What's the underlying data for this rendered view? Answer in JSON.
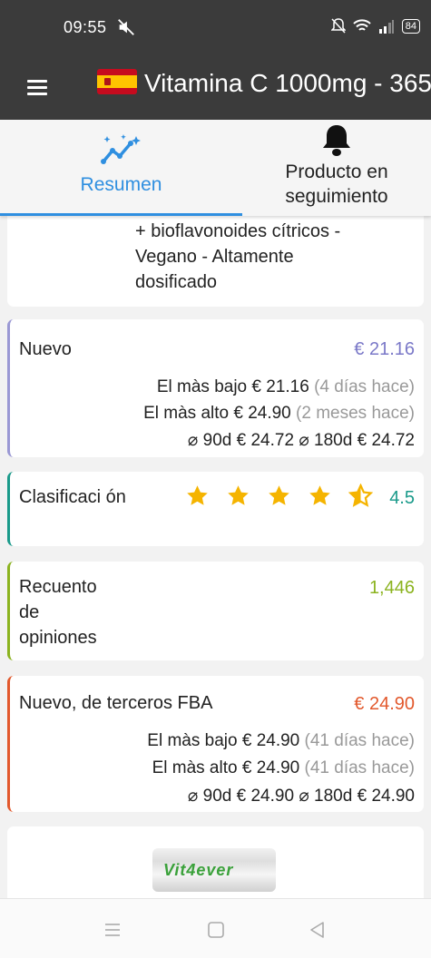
{
  "status": {
    "time": "09:55",
    "battery": "84"
  },
  "app": {
    "title": "Vitamina C 1000mg - 365"
  },
  "tabs": [
    {
      "label": "Resumen",
      "icon": "analytics-sparkle-icon"
    },
    {
      "label": "Producto en seguimiento",
      "icon": "bell-icon"
    }
  ],
  "description": {
    "text": "+ bioflavonoides cítricos - Vegano - Altamente dosificado"
  },
  "new_price": {
    "label": "Nuevo",
    "price": "€ 21.16",
    "color": "#7b79c8",
    "lowest_label": "El màs bajo",
    "lowest_value": "€ 21.16",
    "lowest_when": "(4 días hace)",
    "highest_label": "El màs alto",
    "highest_value": "€ 24.90",
    "highest_when": "(2 meses hace)",
    "avg90_label": "⌀ 90d",
    "avg90_value": "€ 24.72",
    "avg180_label": "⌀ 180d",
    "avg180_value": "€ 24.72"
  },
  "rating": {
    "label": "Clasificaci ón",
    "value": "4.5",
    "stars": 4.5,
    "color": "#1a9a8a"
  },
  "reviews": {
    "label": "Recuento de opiniones",
    "value": "1,446",
    "color": "#8bb31f"
  },
  "fba": {
    "label": "Nuevo, de terceros FBA",
    "price": "€ 24.90",
    "color": "#e2582c",
    "lowest_label": "El màs bajo",
    "lowest_value": "€ 24.90",
    "lowest_when": "(41 días hace)",
    "highest_label": "El màs alto",
    "highest_value": "€ 24.90",
    "highest_when": "(41 días hace)",
    "avg90_label": "⌀ 90d",
    "avg90_value": "€ 24.90",
    "avg180_label": "⌀ 180d",
    "avg180_value": "€ 24.90"
  },
  "product_image": {
    "brand": "Vit4ever"
  },
  "nav": [
    "recents-icon",
    "home-icon",
    "back-icon"
  ]
}
